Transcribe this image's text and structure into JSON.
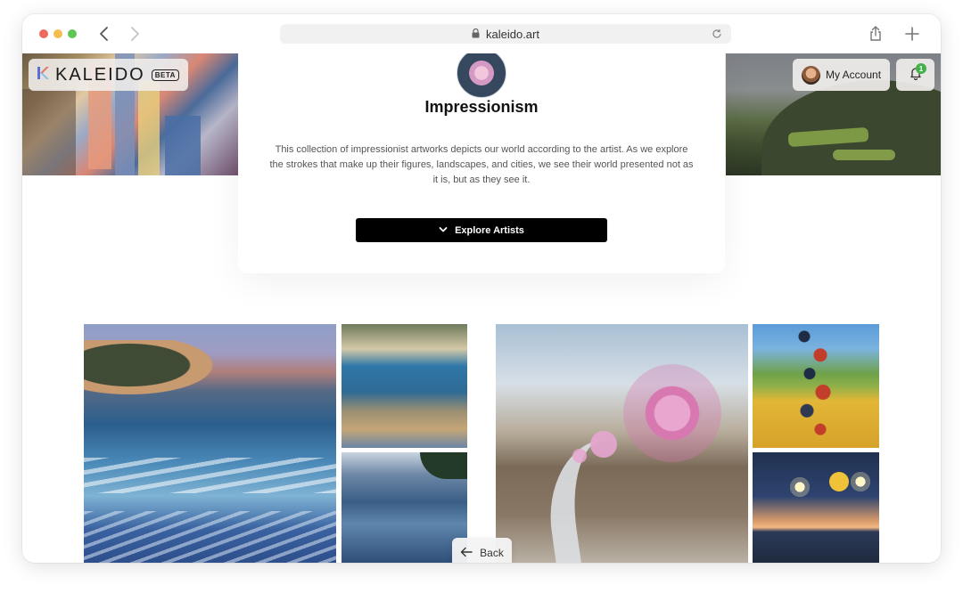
{
  "browser": {
    "url": "kaleido.art"
  },
  "header": {
    "brand": "KALEIDO",
    "badge": "BETA",
    "account_label": "My Account",
    "notification_count": "1"
  },
  "collection": {
    "title": "Impressionism",
    "description": "This collection of impressionist artworks depicts our world according to the artist. As we explore the strokes that make up their figures, landscapes, and cities, we see their world presented not as it is, but as they see it.",
    "explore_label": "Explore Artists"
  },
  "footer": {
    "back_label": "Back"
  },
  "colors": {
    "accent": "#000000",
    "badge_green": "#45b04a"
  }
}
